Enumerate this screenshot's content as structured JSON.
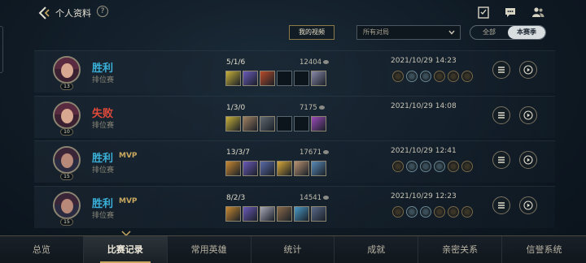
{
  "header": {
    "title": "个人资料",
    "help_symbol": "?",
    "icons": [
      "back-icon",
      "checklist-icon",
      "chat-icon",
      "friends-icon"
    ]
  },
  "filters": {
    "my_videos_label": "我的视频",
    "match_type_value": "所有对局",
    "season_options": [
      "全部",
      "本赛季"
    ],
    "season_selected": "本赛季"
  },
  "matches": [
    {
      "result": "胜利",
      "outcome": "win",
      "mvp": "",
      "mode": "排位赛",
      "level": "13",
      "kda": "5/1/6",
      "gold": "12404",
      "time": "2021/10/29 14:23"
    },
    {
      "result": "失败",
      "outcome": "loss",
      "mvp": "",
      "mode": "排位赛",
      "level": "10",
      "kda": "1/3/0",
      "gold": "7175",
      "time": "2021/10/29 14:08"
    },
    {
      "result": "胜利",
      "outcome": "win",
      "mvp": "MVP",
      "mode": "排位赛",
      "level": "15",
      "kda": "13/3/7",
      "gold": "17671",
      "time": "2021/10/29 12:41"
    },
    {
      "result": "胜利",
      "outcome": "win",
      "mvp": "MVP",
      "mode": "排位赛",
      "level": "15",
      "kda": "8/2/3",
      "gold": "14541",
      "time": "2021/10/29 12:23"
    }
  ],
  "nav": {
    "items": [
      "总览",
      "比赛记录",
      "常用英雄",
      "统计",
      "成就",
      "亲密关系",
      "信誉系统"
    ],
    "active": "比赛记录"
  },
  "colors": {
    "win": "#3ab0d8",
    "loss": "#e04a3a",
    "mvp": "#c8a860",
    "accent_gold": "#c8a860"
  }
}
